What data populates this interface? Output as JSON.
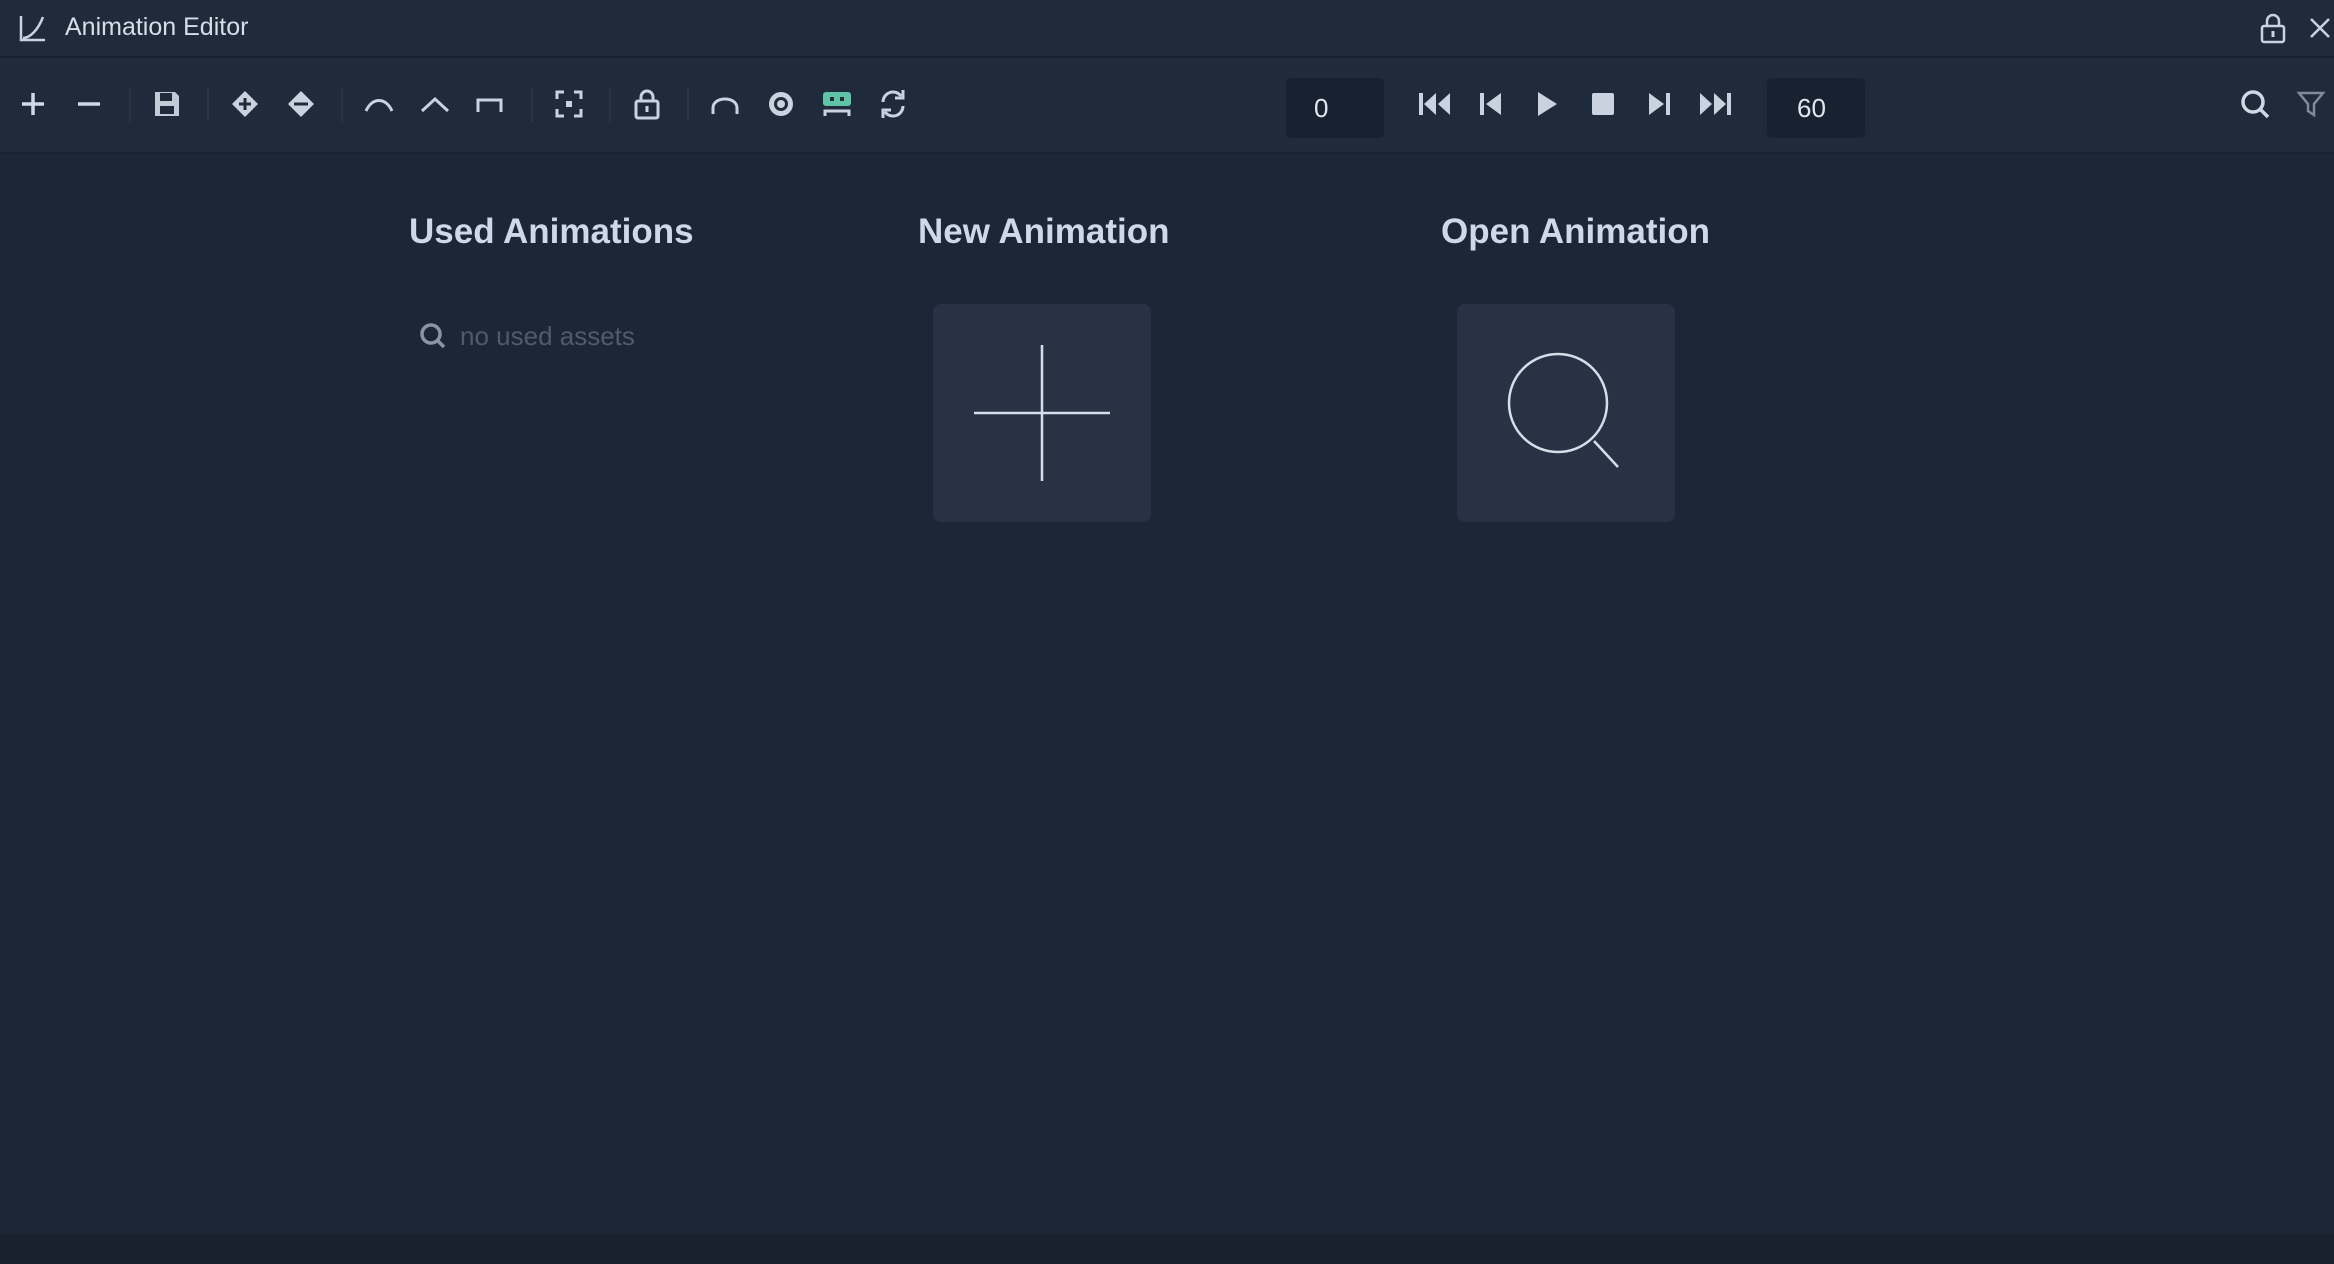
{
  "window": {
    "title": "Animation Editor"
  },
  "toolbar": {
    "frame_start": "0",
    "frame_end": "60",
    "buttons": [
      "add-icon",
      "remove-icon",
      "save-icon",
      "add-keyframe-icon",
      "remove-keyframe-icon",
      "curve-smooth-icon",
      "curve-linear-icon",
      "curve-step-icon",
      "frame-selection-icon",
      "lock-icon",
      "curve-edit-icon",
      "visibility-icon",
      "robot-icon",
      "loop-icon",
      "first-frame-icon",
      "previous-frame-icon",
      "play-icon",
      "stop-icon",
      "next-frame-icon",
      "last-frame-icon",
      "search-icon",
      "filter-icon"
    ]
  },
  "main": {
    "used_title": "Used Animations",
    "used_empty": "no used assets",
    "new_title": "New Animation",
    "open_title": "Open Animation"
  },
  "colors": {
    "background": "#1c2636",
    "toolbar": "#1f2a3a",
    "tile": "#273345",
    "accent_green": "#5fc4a6",
    "icon": "#c9d2de"
  }
}
